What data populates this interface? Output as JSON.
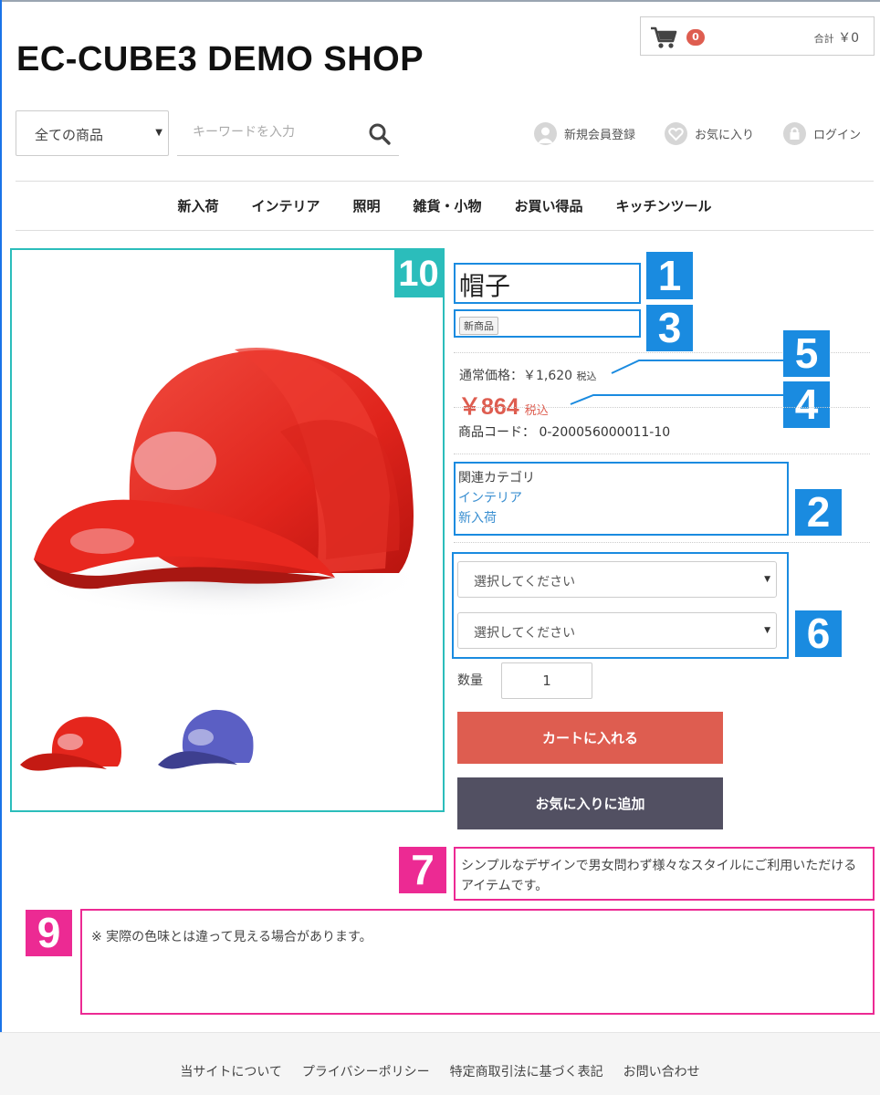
{
  "header": {
    "shop_title": "EC-CUBE3 DEMO SHOP",
    "cart": {
      "count": "0",
      "total_label": "合計",
      "total_value": "￥0"
    },
    "category_select": {
      "selected": "全ての商品"
    },
    "search": {
      "placeholder": "キーワードを入力"
    },
    "utility": {
      "register": "新規会員登録",
      "favorites": "お気に入り",
      "login": "ログイン"
    }
  },
  "global_nav": {
    "items": [
      "新入荷",
      "インテリア",
      "照明",
      "雑貨・小物",
      "お買い得品",
      "キッチンツール"
    ]
  },
  "product": {
    "name": "帽子",
    "badge": "新商品",
    "regular_price_label": "通常価格：",
    "regular_price": "￥1,620",
    "regular_price_tax": "税込",
    "sale_price": "￥864",
    "sale_price_tax": "税込",
    "code_label": "商品コード：",
    "code": "0-200056000011-10",
    "related_heading": "関連カテゴリ",
    "related_categories": [
      "インテリア",
      "新入荷"
    ],
    "class_select_1": "選択してください",
    "class_select_2": "選択してください",
    "quantity_label": "数量",
    "quantity": "1",
    "add_to_cart": "カートに入れる",
    "add_to_favorites": "お気に入りに追加",
    "description": "シンプルなデザインで男女問わず様々なスタイルにご利用いただけるアイテムです。",
    "free_area": "※ 実際の色味とは違って見える場合があります。",
    "images": {
      "main": "red cap",
      "thumbnails": [
        "red cap",
        "blue cap"
      ]
    }
  },
  "annotations": {
    "c1": "1",
    "c2": "2",
    "c3": "3",
    "c4": "4",
    "c5": "5",
    "c6": "6",
    "c7": "7",
    "c9": "9",
    "c10": "10"
  },
  "colors": {
    "accent_red": "#de5d50",
    "favorite_button": "#525062",
    "callout_blue": "#1a8be0",
    "callout_pink": "#ec2a93",
    "callout_teal": "#2bbdbb",
    "link_blue": "#3a8fd1"
  },
  "footer": {
    "links": [
      "当サイトについて",
      "プライバシーポリシー",
      "特定商取引法に基づく表記",
      "お問い合わせ"
    ]
  }
}
